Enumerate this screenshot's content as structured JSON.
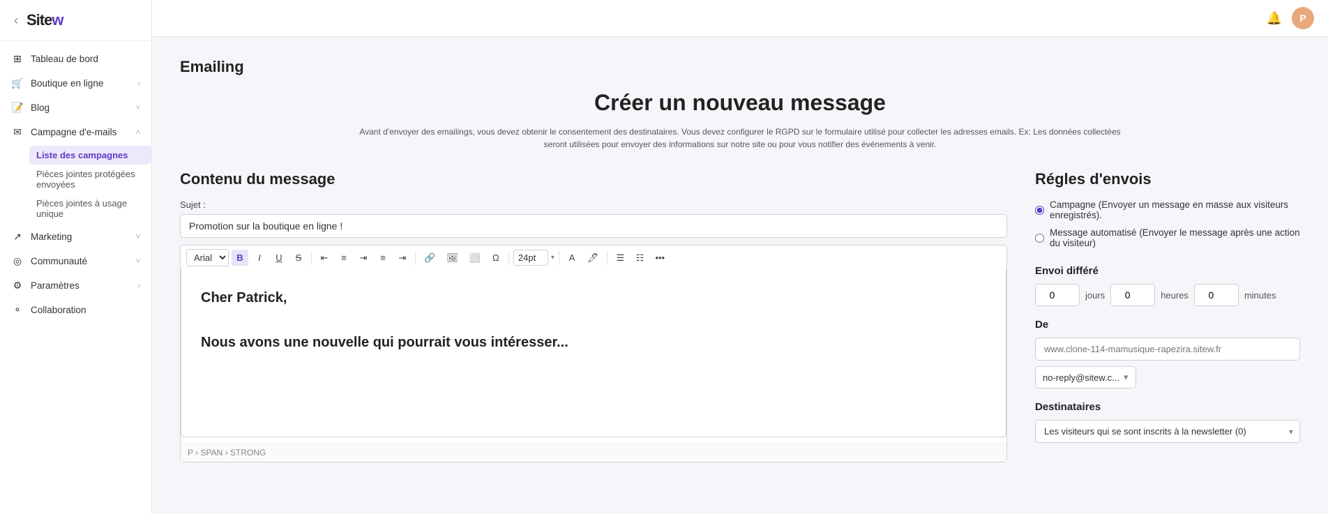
{
  "sidebar": {
    "logo": "Site",
    "logo_w": "w",
    "nav_items": [
      {
        "id": "tableau",
        "icon": "⊞",
        "label": "Tableau de bord",
        "hasChevron": false
      },
      {
        "id": "boutique",
        "icon": "🛒",
        "label": "Boutique en ligne",
        "hasChevron": true
      },
      {
        "id": "blog",
        "icon": "📝",
        "label": "Blog",
        "hasChevron": true
      },
      {
        "id": "campagne",
        "icon": "✉",
        "label": "Campagne d'e-mails",
        "hasChevron": true
      },
      {
        "id": "marketing",
        "icon": "📈",
        "label": "Marketing",
        "hasChevron": true
      },
      {
        "id": "communaute",
        "icon": "👥",
        "label": "Communauté",
        "hasChevron": true
      },
      {
        "id": "parametres",
        "icon": "⚙",
        "label": "Paramètres",
        "hasChevron": true
      },
      {
        "id": "collaboration",
        "icon": "🤝",
        "label": "Collaboration",
        "hasChevron": false
      }
    ],
    "sub_items": [
      {
        "id": "liste",
        "label": "Liste des campagnes",
        "active": true
      },
      {
        "id": "pj-protegees",
        "label": "Pièces jointes protégées envoyées"
      },
      {
        "id": "pj-unique",
        "label": "Pièces jointes à usage unique"
      }
    ]
  },
  "topbar": {
    "avatar_letter": "P"
  },
  "page": {
    "breadcrumb": "Emailing",
    "main_title": "Créer un nouveau message",
    "notice": "Avant d'envoyer des emailings, vous devez obtenir le consentement des destinataires. Vous devez configurer le RGPD sur le formulaire utilisé pour collecter les adresses emails. Ex: Les données collectées seront utilisées pour envoyer des informations sur notre site ou pour vous notifier des événements à venir."
  },
  "content": {
    "section_title": "Contenu du message",
    "subject_label": "Sujet :",
    "subject_value": "Promotion sur la boutique en ligne !",
    "font_family": "Arial",
    "font_size": "24pt",
    "editor_body": "Cher Patrick,\n\nNous avons une nouvelle qui pourrait vous intéresser...",
    "breadcrumb_path": "P › SPAN › STRONG"
  },
  "rules": {
    "section_title": "Régles d'envois",
    "radio_options": [
      {
        "id": "campagne",
        "label": "Campagne (Envoyer un message en masse aux visiteurs enregistrés).",
        "checked": true
      },
      {
        "id": "automatise",
        "label": "Message automatisé (Envoyer le message après une action du visiteur)",
        "checked": false
      }
    ],
    "envoi_differe": {
      "title": "Envoi différé",
      "jours": "0",
      "heures": "0",
      "minutes": "0",
      "label_jours": "jours",
      "label_heures": "heures",
      "label_minutes": "minutes"
    },
    "de": {
      "title": "De",
      "placeholder": "www.clone-114-mamusique-rapezira.sitew.fr",
      "dropdown": "no-reply@sitew.c...",
      "dropdown_chevron": "▾"
    },
    "destinataires": {
      "title": "Destinataires",
      "value": "Les visiteurs qui se sont inscrits à la newsletter (0)"
    }
  },
  "toolbar": {
    "bold": "B",
    "italic": "I",
    "underline": "U",
    "strikethrough": "S",
    "align_left": "≡",
    "align_center": "≡",
    "align_right": "≡",
    "align_justify": "≡",
    "indent": "⇥",
    "link": "🔗",
    "image": "🖼",
    "more": "..."
  }
}
